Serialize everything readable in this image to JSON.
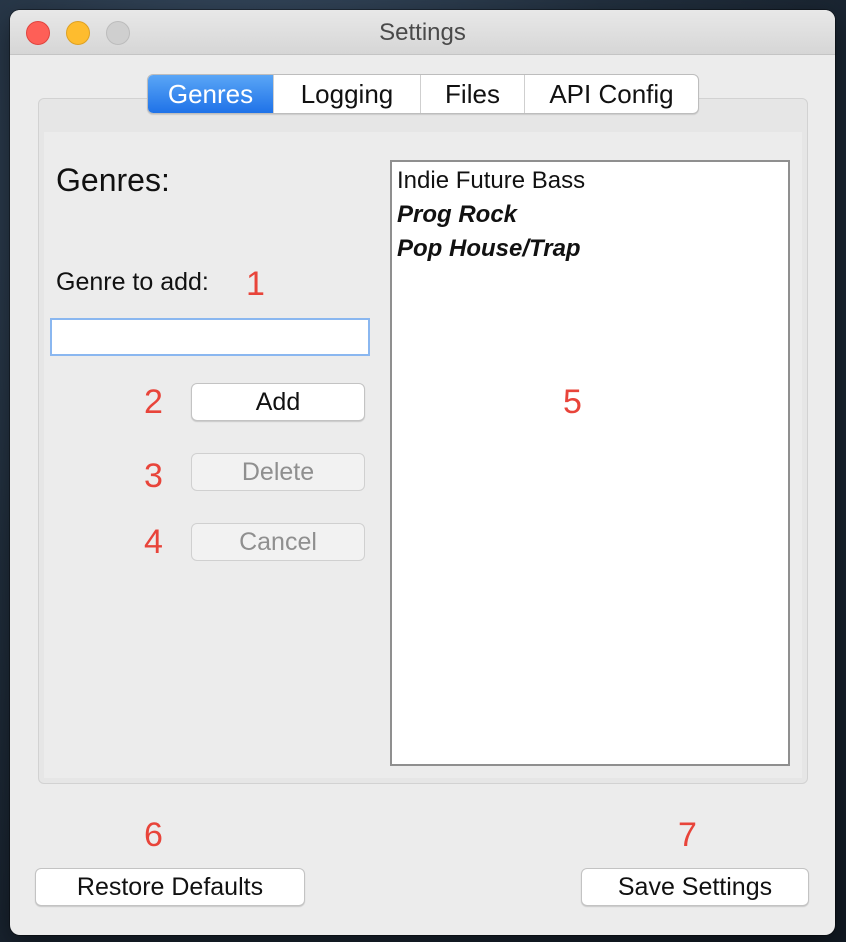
{
  "window": {
    "title": "Settings"
  },
  "tabs": [
    {
      "label": "Genres",
      "active": true
    },
    {
      "label": "Logging",
      "active": false
    },
    {
      "label": "Files",
      "active": false
    },
    {
      "label": "API Config",
      "active": false
    }
  ],
  "genres_panel": {
    "heading": "Genres:",
    "add_label": "Genre to add:",
    "input_value": "",
    "add_button": "Add",
    "delete_button": "Delete",
    "cancel_button": "Cancel",
    "list_items": [
      {
        "label": "Indie Future Bass",
        "style": "regular"
      },
      {
        "label": "Prog Rock",
        "style": "bold-italic"
      },
      {
        "label": "Pop House/Trap",
        "style": "bold-italic"
      }
    ]
  },
  "footer": {
    "restore_button": "Restore Defaults",
    "save_button": "Save Settings"
  },
  "annotations": [
    "1",
    "2",
    "3",
    "4",
    "5",
    "6",
    "7"
  ],
  "colors": {
    "accent": "#1f72e8",
    "annotation": "#e8443a",
    "close": "#fe5f57",
    "minimize": "#febc2e"
  }
}
